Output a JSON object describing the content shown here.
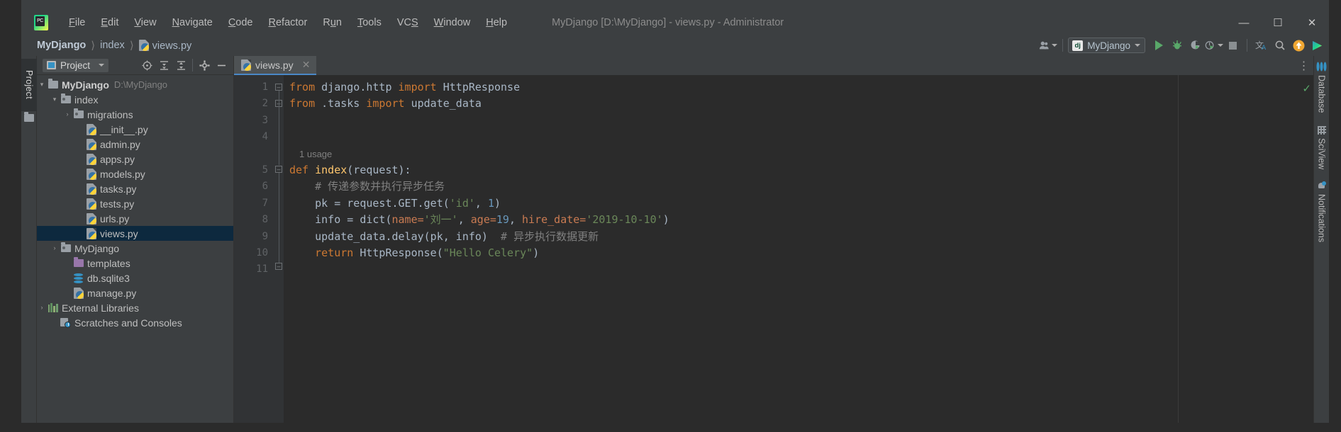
{
  "window": {
    "title": "MyDjango [D:\\MyDjango] - views.py - Administrator",
    "logo_badge": "PC",
    "minimize": "─",
    "maximize": "☐",
    "close": "✕"
  },
  "menubar": [
    {
      "label": "File",
      "mnemonic": "F"
    },
    {
      "label": "Edit",
      "mnemonic": "E"
    },
    {
      "label": "View",
      "mnemonic": "V"
    },
    {
      "label": "Navigate",
      "mnemonic": "N"
    },
    {
      "label": "Code",
      "mnemonic": "C"
    },
    {
      "label": "Refactor",
      "mnemonic": "R"
    },
    {
      "label": "Run",
      "mnemonic": "u"
    },
    {
      "label": "Tools",
      "mnemonic": "T"
    },
    {
      "label": "VCS",
      "mnemonic": "S"
    },
    {
      "label": "Window",
      "mnemonic": "W"
    },
    {
      "label": "Help",
      "mnemonic": "H"
    }
  ],
  "breadcrumb": {
    "items": [
      "MyDjango",
      "index",
      "views.py"
    ],
    "separator": "⟩",
    "file_icon": "python-file-icon"
  },
  "toolbar": {
    "run_config": {
      "label": "MyDjango",
      "badge": "dj"
    },
    "buttons": [
      {
        "name": "user-account-icon",
        "label": ""
      },
      {
        "name": "run-button",
        "label": ""
      },
      {
        "name": "debug-button",
        "label": ""
      },
      {
        "name": "run-coverage-button",
        "label": ""
      },
      {
        "name": "profile-button",
        "label": ""
      },
      {
        "name": "stop-button",
        "label": ""
      },
      {
        "name": "translate-icon",
        "label": "文A"
      },
      {
        "name": "search-everywhere-icon",
        "label": ""
      },
      {
        "name": "update-project-icon",
        "label": "↑"
      },
      {
        "name": "settings-sync-icon",
        "label": ""
      }
    ]
  },
  "left_strip": {
    "project_tab": "Project",
    "folder_icon": "folder-icon"
  },
  "project_panel": {
    "title": "Project",
    "tools": [
      {
        "name": "select-opened-file-icon",
        "glyph": "⊕"
      },
      {
        "name": "expand-all-icon",
        "glyph": "⨅"
      },
      {
        "name": "collapse-all-icon",
        "glyph": "⨄"
      },
      {
        "name": "settings-gear-icon",
        "glyph": "⚙"
      },
      {
        "name": "hide-panel-icon",
        "glyph": "─"
      }
    ],
    "tree": [
      {
        "indent": 0,
        "arrow": "⌄",
        "icon": "folder",
        "name": "MyDjango",
        "bold": true,
        "sub": "D:\\MyDjango",
        "selected": false
      },
      {
        "indent": 1,
        "arrow": "⌄",
        "icon": "folder-module",
        "name": "index",
        "bold": false,
        "sub": "",
        "selected": false
      },
      {
        "indent": 2,
        "arrow": "›",
        "icon": "folder-module",
        "name": "migrations",
        "bold": false,
        "sub": "",
        "selected": false
      },
      {
        "indent": 3,
        "arrow": "",
        "icon": "python",
        "name": "__init__.py",
        "bold": false,
        "sub": "",
        "selected": false
      },
      {
        "indent": 3,
        "arrow": "",
        "icon": "python",
        "name": "admin.py",
        "bold": false,
        "sub": "",
        "selected": false
      },
      {
        "indent": 3,
        "arrow": "",
        "icon": "python",
        "name": "apps.py",
        "bold": false,
        "sub": "",
        "selected": false
      },
      {
        "indent": 3,
        "arrow": "",
        "icon": "python",
        "name": "models.py",
        "bold": false,
        "sub": "",
        "selected": false
      },
      {
        "indent": 3,
        "arrow": "",
        "icon": "python",
        "name": "tasks.py",
        "bold": false,
        "sub": "",
        "selected": false
      },
      {
        "indent": 3,
        "arrow": "",
        "icon": "python",
        "name": "tests.py",
        "bold": false,
        "sub": "",
        "selected": false
      },
      {
        "indent": 3,
        "arrow": "",
        "icon": "python",
        "name": "urls.py",
        "bold": false,
        "sub": "",
        "selected": false
      },
      {
        "indent": 3,
        "arrow": "",
        "icon": "python",
        "name": "views.py",
        "bold": false,
        "sub": "",
        "selected": true
      },
      {
        "indent": 1,
        "arrow": "›",
        "icon": "folder-module",
        "name": "MyDjango",
        "bold": false,
        "sub": "",
        "selected": false
      },
      {
        "indent": 2,
        "arrow": "",
        "icon": "folder-purple",
        "name": "templates",
        "bold": false,
        "sub": "",
        "selected": false
      },
      {
        "indent": 2,
        "arrow": "",
        "icon": "database",
        "name": "db.sqlite3",
        "bold": false,
        "sub": "",
        "selected": false
      },
      {
        "indent": 2,
        "arrow": "",
        "icon": "python",
        "name": "manage.py",
        "bold": false,
        "sub": "",
        "selected": false
      },
      {
        "indent": 0,
        "arrow": "›",
        "icon": "library",
        "name": "External Libraries",
        "bold": false,
        "sub": "",
        "selected": false
      },
      {
        "indent": 1,
        "arrow": "",
        "icon": "scratch",
        "name": "Scratches and Consoles",
        "bold": false,
        "sub": "",
        "selected": false
      }
    ]
  },
  "editor": {
    "tab": {
      "label": "views.py",
      "close": "✕",
      "icon": "python-file-icon"
    },
    "options_glyph": "⋮",
    "inspection_status": "✓",
    "gutter_numbers": [
      "1",
      "2",
      "3",
      "4",
      "5",
      "6",
      "7",
      "8",
      "9",
      "10",
      "11"
    ],
    "code_lines": [
      {
        "n": 1,
        "tokens": [
          {
            "t": "from ",
            "c": "kw"
          },
          {
            "t": "django.http ",
            "c": "id"
          },
          {
            "t": "import ",
            "c": "kw"
          },
          {
            "t": "HttpResponse",
            "c": "id"
          }
        ]
      },
      {
        "n": 2,
        "tokens": [
          {
            "t": "from ",
            "c": "kw"
          },
          {
            "t": ".tasks ",
            "c": "id"
          },
          {
            "t": "import ",
            "c": "kw"
          },
          {
            "t": "update_data",
            "c": "id"
          }
        ]
      },
      {
        "n": 3,
        "tokens": []
      },
      {
        "n": 4,
        "tokens": []
      },
      {
        "n": "hint",
        "hint": "1 usage",
        "tokens": []
      },
      {
        "n": 5,
        "tokens": [
          {
            "t": "def ",
            "c": "kw"
          },
          {
            "t": "index",
            "c": "fn"
          },
          {
            "t": "(request):",
            "c": "id"
          }
        ]
      },
      {
        "n": 6,
        "tokens": [
          {
            "t": "    # 传递参数并执行异步任务",
            "c": "cmt"
          }
        ]
      },
      {
        "n": 7,
        "tokens": [
          {
            "t": "    pk = request.GET.get(",
            "c": "id"
          },
          {
            "t": "'id'",
            "c": "str"
          },
          {
            "t": ", ",
            "c": "id"
          },
          {
            "t": "1",
            "c": "num"
          },
          {
            "t": ")",
            "c": "id"
          }
        ]
      },
      {
        "n": 8,
        "tokens": [
          {
            "t": "    info = dict(",
            "c": "id"
          },
          {
            "t": "name=",
            "c": "kwarg"
          },
          {
            "t": "'刘一'",
            "c": "str"
          },
          {
            "t": ", ",
            "c": "id"
          },
          {
            "t": "age=",
            "c": "kwarg"
          },
          {
            "t": "19",
            "c": "num"
          },
          {
            "t": ", ",
            "c": "id"
          },
          {
            "t": "hire_date=",
            "c": "kwarg"
          },
          {
            "t": "'2019-10-10'",
            "c": "str"
          },
          {
            "t": ")",
            "c": "id"
          }
        ]
      },
      {
        "n": 9,
        "tokens": [
          {
            "t": "    update_data.delay(pk, info)  ",
            "c": "id"
          },
          {
            "t": "# 异步执行数据更新",
            "c": "cmt"
          }
        ]
      },
      {
        "n": 10,
        "tokens": [
          {
            "t": "    return ",
            "c": "kw"
          },
          {
            "t": "HttpResponse(",
            "c": "id"
          },
          {
            "t": "\"Hello Celery\"",
            "c": "str"
          },
          {
            "t": ")",
            "c": "id"
          }
        ]
      },
      {
        "n": 11,
        "tokens": []
      }
    ]
  },
  "right_strip": {
    "tabs": [
      {
        "label": "Database",
        "icon": "database-icon"
      },
      {
        "label": "SciView",
        "icon": "grid-icon"
      },
      {
        "label": "Notifications",
        "icon": "bell-icon"
      }
    ]
  },
  "colors": {
    "background": "#3c3f41",
    "editor_bg": "#2b2b2b",
    "selection": "#0d293e",
    "keyword": "#cc7832",
    "string": "#6a8759",
    "number": "#6897bb",
    "function": "#ffc66d",
    "comment": "#808080",
    "identifier": "#a9b7c6",
    "accent": "#4a88c7",
    "run_green": "#59a869"
  }
}
